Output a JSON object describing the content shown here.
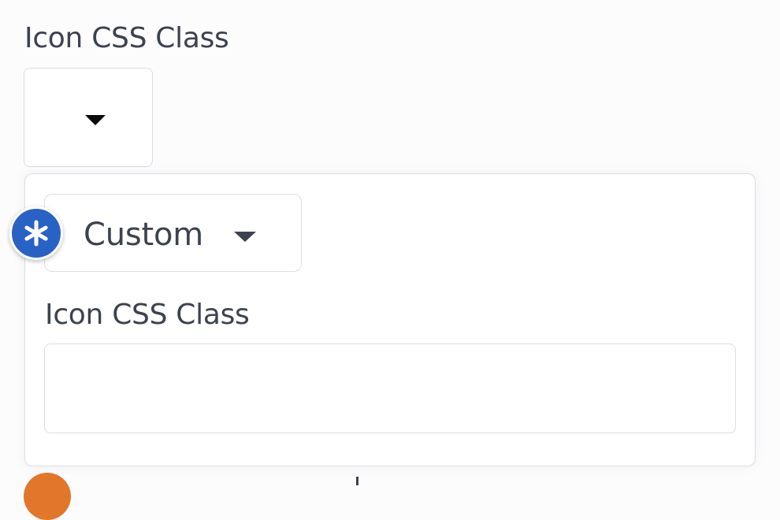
{
  "top_section": {
    "label": "Icon CSS Class"
  },
  "icon_picker": {
    "caret_icon": "caret-down-icon",
    "has_value": false
  },
  "popover": {
    "type_select": {
      "selected": "Custom",
      "caret_icon": "caret-down-icon"
    },
    "required_badge_icon": "asterisk-icon",
    "class_field": {
      "label": "Icon CSS Class",
      "value": ""
    }
  },
  "colors": {
    "badge_blue": "#2962c5",
    "border": "#dcdee5",
    "text": "#3d4250",
    "partial_badge_orange": "#e2762a"
  }
}
